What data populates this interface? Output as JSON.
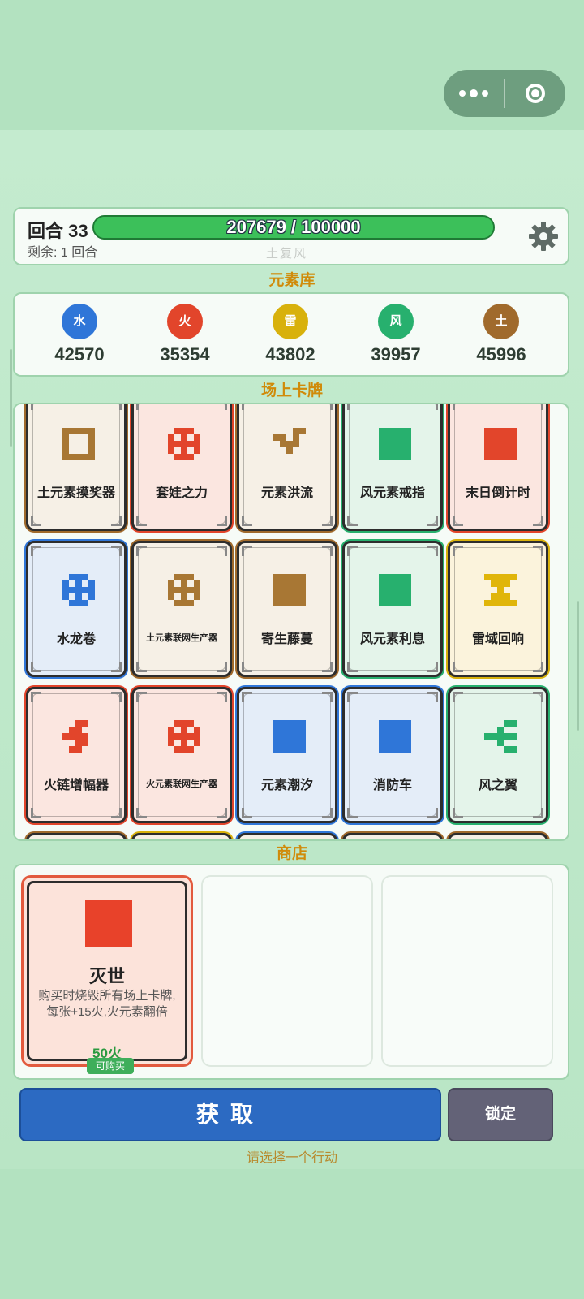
{
  "header": {
    "round_label": "回合 33",
    "remaining_label": "剩余: 1 回合",
    "progress_text": "207679 / 100000",
    "progress_ratio": 1.0,
    "subtitle": "土复风"
  },
  "labels": {
    "element_bank": "元素库",
    "board": "场上卡牌",
    "shop": "商店"
  },
  "elements": [
    {
      "name": "水",
      "value": "42570",
      "color": "#2f76d8"
    },
    {
      "name": "火",
      "value": "35354",
      "color": "#e2452b"
    },
    {
      "name": "雷",
      "value": "43802",
      "color": "#d8b10c"
    },
    {
      "name": "风",
      "value": "39957",
      "color": "#27b06e"
    },
    {
      "name": "土",
      "value": "45996",
      "color": "#a06a2c"
    }
  ],
  "board_cards": [
    {
      "name": "土元素摸奖器",
      "icon": "brown-hollow-square-icon",
      "bg": "#f6f0e6",
      "border": "#a06a2c",
      "accent": "#a87734"
    },
    {
      "name": "套娃之力",
      "icon": "red-grid-icon",
      "bg": "#fbe6e0",
      "border": "#e2452b",
      "accent": "#e2452b"
    },
    {
      "name": "元素洪流",
      "icon": "brown-zigzag-icon",
      "bg": "#f6f0e6",
      "border": "#a06a2c",
      "accent": "#a87734"
    },
    {
      "name": "风元素戒指",
      "icon": "green-square-icon",
      "bg": "#e4f4ea",
      "border": "#27b06e",
      "accent": "#27b06e"
    },
    {
      "name": "末日倒计时",
      "icon": "red-square-icon",
      "bg": "#fbe6e0",
      "border": "#e2452b",
      "accent": "#e2452b"
    },
    {
      "name": "水龙卷",
      "icon": "blue-grid-icon",
      "bg": "#e4edf8",
      "border": "#2f76d8",
      "accent": "#2f76d8"
    },
    {
      "name": "土元素联网生产器",
      "icon": "brown-grid-icon",
      "bg": "#f6f0e6",
      "border": "#a06a2c",
      "accent": "#a87734",
      "small": true
    },
    {
      "name": "寄生藤蔓",
      "icon": "brown-square-icon",
      "bg": "#f6f0e6",
      "border": "#a06a2c",
      "accent": "#a87734"
    },
    {
      "name": "风元素利息",
      "icon": "green-square-icon",
      "bg": "#e4f4ea",
      "border": "#27b06e",
      "accent": "#27b06e"
    },
    {
      "name": "雷域回响",
      "icon": "yellow-hourglass-icon",
      "bg": "#fbf3dc",
      "border": "#d8b10c",
      "accent": "#e0b50a"
    },
    {
      "name": "火链增幅器",
      "icon": "red-s-shape-icon",
      "bg": "#fbe6e0",
      "border": "#e2452b",
      "accent": "#e2452b"
    },
    {
      "name": "火元素联网生产器",
      "icon": "red-grid-icon",
      "bg": "#fbe6e0",
      "border": "#e2452b",
      "accent": "#e2452b",
      "small": true
    },
    {
      "name": "元素潮汐",
      "icon": "blue-square-icon",
      "bg": "#e4edf8",
      "border": "#2f76d8",
      "accent": "#2f76d8"
    },
    {
      "name": "消防车",
      "icon": "blue-square-icon",
      "bg": "#e4edf8",
      "border": "#2f76d8",
      "accent": "#2f76d8"
    },
    {
      "name": "风之翼",
      "icon": "green-arrow-icon",
      "bg": "#e4f4ea",
      "border": "#27b06e",
      "accent": "#27b06e"
    }
  ],
  "shop": {
    "card": {
      "title": "灭世",
      "desc": "购买时烧毁所有场上卡牌,每张+15火,火元素翻倍",
      "price": "50火",
      "status": "可购买",
      "icon": "red-square-icon",
      "color": "#e8422a"
    }
  },
  "actions": {
    "get_label": "获取",
    "lock_label": "锁定",
    "hint": "请选择一个行动"
  },
  "icons": {
    "settings": "gear-icon",
    "menu": "more-dots-icon",
    "close": "close-circle-icon"
  }
}
